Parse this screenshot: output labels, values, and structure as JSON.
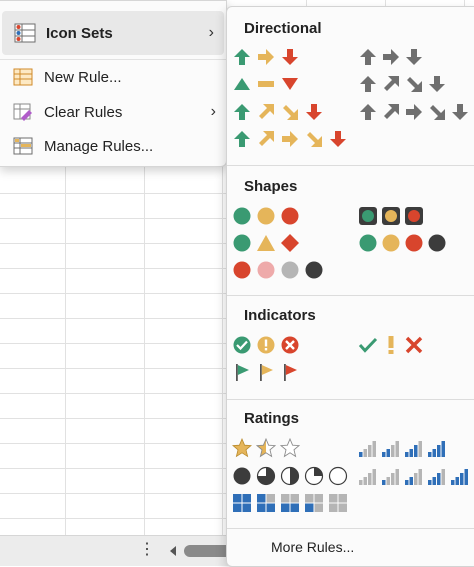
{
  "menu": {
    "icon_sets_label": "Icon Sets",
    "new_rule_label": "New Rule...",
    "clear_rules_label": "Clear Rules",
    "manage_rules_label": "Manage Rules..."
  },
  "submenu": {
    "directional_title": "Directional",
    "shapes_title": "Shapes",
    "indicators_title": "Indicators",
    "ratings_title": "Ratings",
    "more_rules_label": "More Rules..."
  },
  "colors": {
    "green": "#3a9a72",
    "yellow": "#e5b55a",
    "red": "#d8452d",
    "gray": "#6f6f6f",
    "blue": "#2f6fb8",
    "light_gray": "#b5b5b5",
    "pink": "#eeaaaa",
    "black": "#3c3c3c"
  }
}
